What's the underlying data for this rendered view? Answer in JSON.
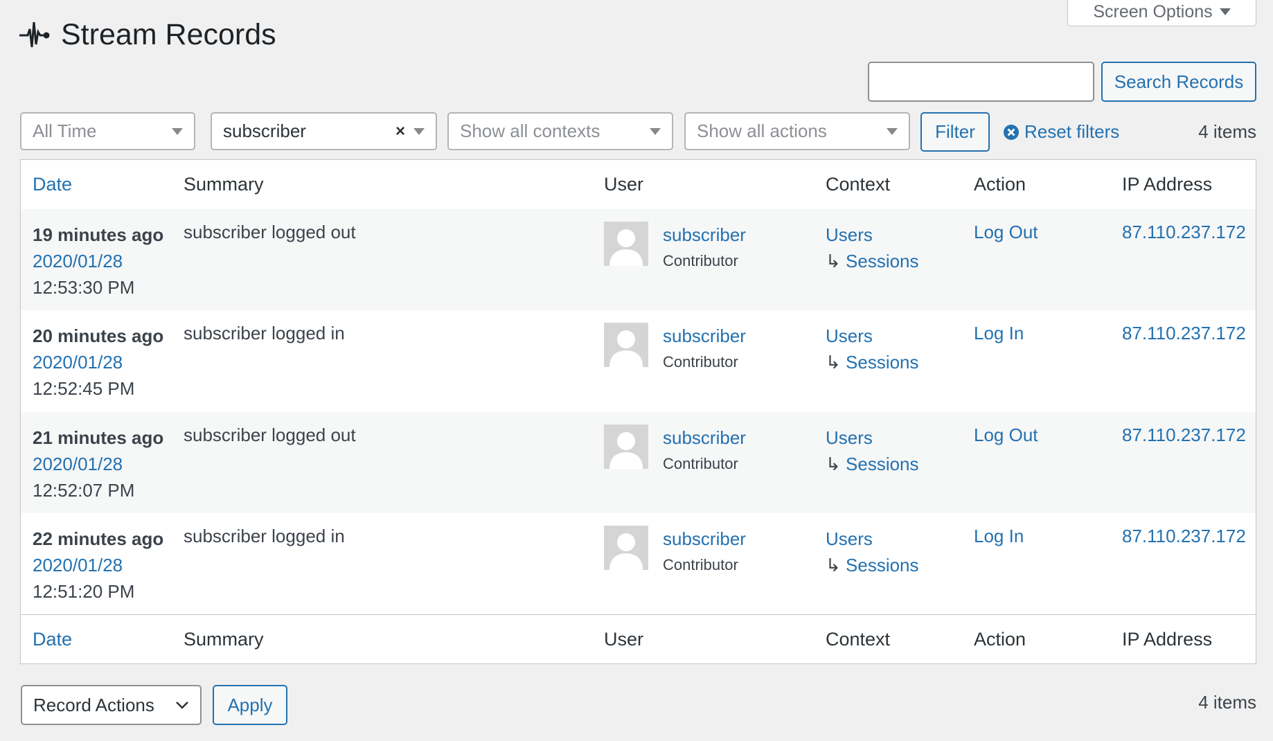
{
  "header": {
    "title": "Stream Records",
    "screen_options": "Screen Options"
  },
  "search": {
    "value": "",
    "button": "Search Records"
  },
  "filters": {
    "date": "All Time",
    "user": "subscriber",
    "context": "Show all contexts",
    "action": "Show all actions",
    "filter_button": "Filter",
    "reset": "Reset filters",
    "count": "4 items"
  },
  "columns": {
    "date": "Date",
    "summary": "Summary",
    "user": "User",
    "context": "Context",
    "action": "Action",
    "ip": "IP Address"
  },
  "rows": [
    {
      "ago": "19 minutes ago",
      "date": "2020/01/28",
      "time": "12:53:30 PM",
      "summary": "subscriber logged out",
      "user": "subscriber",
      "role": "Contributor",
      "context": "Users",
      "subcontext": "Sessions",
      "action": "Log Out",
      "ip": "87.110.237.172"
    },
    {
      "ago": "20 minutes ago",
      "date": "2020/01/28",
      "time": "12:52:45 PM",
      "summary": "subscriber logged in",
      "user": "subscriber",
      "role": "Contributor",
      "context": "Users",
      "subcontext": "Sessions",
      "action": "Log In",
      "ip": "87.110.237.172"
    },
    {
      "ago": "21 minutes ago",
      "date": "2020/01/28",
      "time": "12:52:07 PM",
      "summary": "subscriber logged out",
      "user": "subscriber",
      "role": "Contributor",
      "context": "Users",
      "subcontext": "Sessions",
      "action": "Log Out",
      "ip": "87.110.237.172"
    },
    {
      "ago": "22 minutes ago",
      "date": "2020/01/28",
      "time": "12:51:20 PM",
      "summary": "subscriber logged in",
      "user": "subscriber",
      "role": "Contributor",
      "context": "Users",
      "subcontext": "Sessions",
      "action": "Log In",
      "ip": "87.110.237.172"
    }
  ],
  "bottom": {
    "bulk": "Record Actions",
    "apply": "Apply",
    "count": "4 items"
  },
  "colors": {
    "link": "#2271b1",
    "text": "#3c434a",
    "background": "#f0f0f1"
  }
}
